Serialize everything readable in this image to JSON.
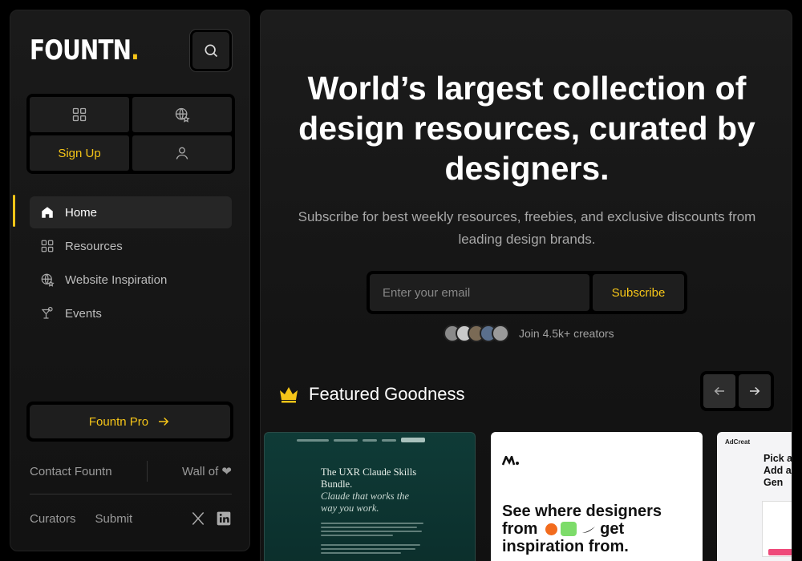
{
  "sidebar": {
    "logo_text": "FOUNTN",
    "logo_dot": ".",
    "grid": {
      "signup_label": "Sign Up"
    },
    "nav": [
      {
        "label": "Home",
        "icon": "home-icon"
      },
      {
        "label": "Resources",
        "icon": "grid-icon"
      },
      {
        "label": "Website Inspiration",
        "icon": "globe-star-icon"
      },
      {
        "label": "Events",
        "icon": "cocktail-icon"
      }
    ],
    "pro_label": "Fountn Pro",
    "footer": {
      "contact": "Contact Fountn",
      "wall": "Wall of ❤",
      "curators": "Curators",
      "submit": "Submit"
    }
  },
  "hero": {
    "title": "World’s largest collection of design resources, curated by designers.",
    "subtitle": "Subscribe for best weekly resources, freebies, and exclusive discounts from leading design brands.",
    "email_placeholder": "Enter your email",
    "subscribe_label": "Subscribe",
    "creators_text": "Join 4.5k+ creators"
  },
  "featured": {
    "title": "Featured Goodness",
    "cards": [
      {
        "title": "The UXR Claude Skills Bundle.",
        "italic": "Claude that works the way you work."
      },
      {
        "text_line1": "See where designers",
        "text_line2a": "from",
        "text_line2b": "get",
        "text_line3": "inspiration from."
      },
      {
        "brand": "AdCreat",
        "text": "Pick a I Add a I AI Gen"
      }
    ]
  },
  "colors": {
    "accent": "#f5c518",
    "bg": "#000000",
    "panel": "#1e1e1e"
  }
}
